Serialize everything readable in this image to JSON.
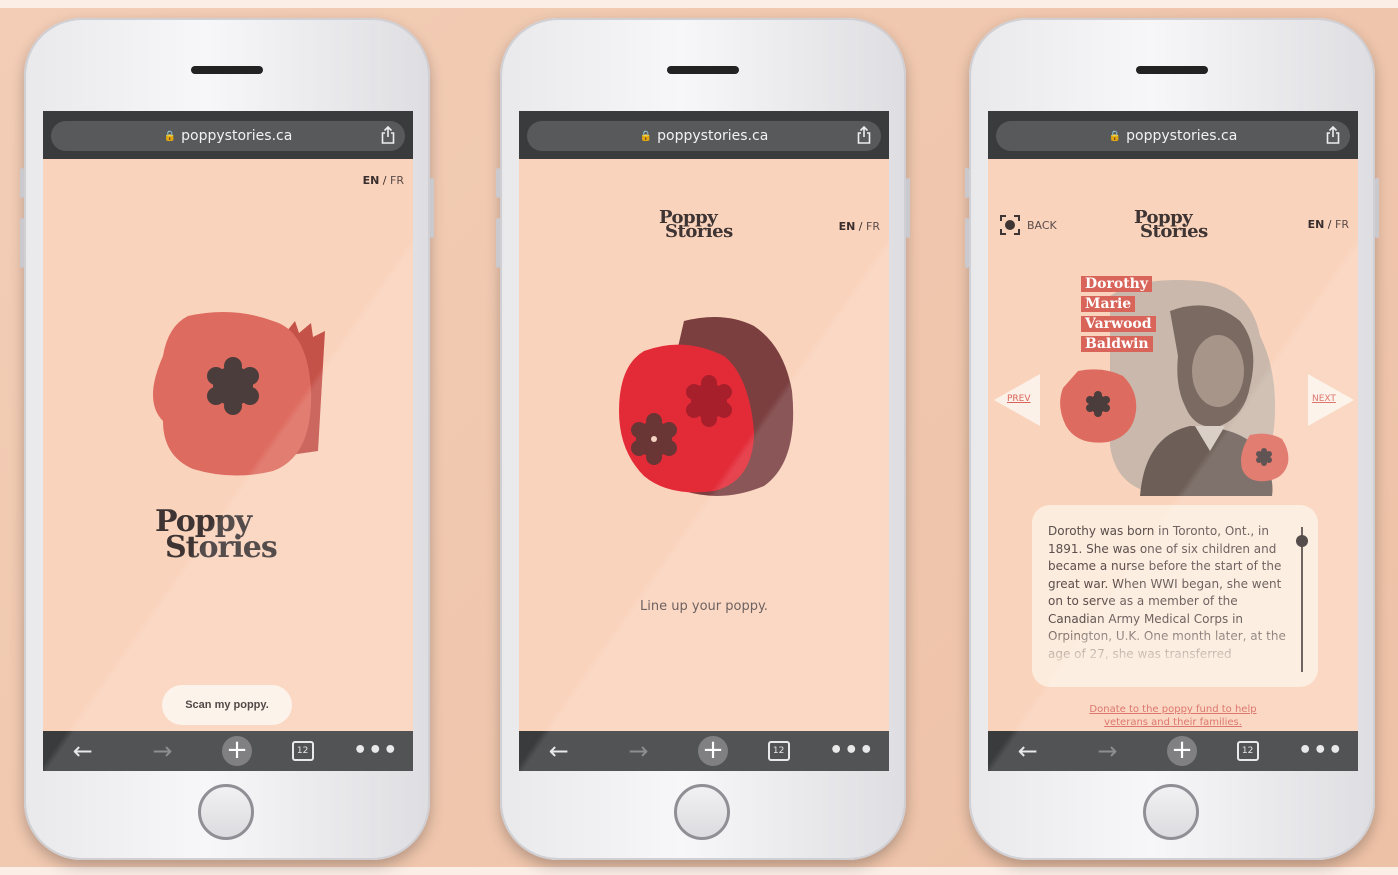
{
  "browser": {
    "url": "poppystories.ca",
    "tab_count": "12"
  },
  "language": {
    "en": "EN",
    "sep": "/",
    "fr": "FR"
  },
  "logo": {
    "line1": "Poppy",
    "line2": "Stories"
  },
  "screen1": {
    "scan_button": "Scan my poppy."
  },
  "screen2": {
    "instruction": "Line up your poppy."
  },
  "screen3": {
    "back_label": "BACK",
    "name_lines": [
      "Dorothy",
      "Marie",
      "Varwood",
      "Baldwin"
    ],
    "prev_label": "PREV",
    "next_label": "NEXT",
    "bio": "Dorothy was born in Toronto, Ont., in 1891. She was one of six children and became a nurse before the start of the great war. When WWI began, she went on to serve as a member of the Canadian Army Medical Corps in Orpington, U.K. One month later, at the age of 27, she was transferred",
    "donate_line1": "Donate to the poppy fund to help",
    "donate_line2": "veterans and their families."
  },
  "colors": {
    "screen_bg": "#fad3bc",
    "poppy_red": "#d8645a",
    "bright_red": "#e32b38",
    "dark_brown": "#3d3433",
    "browser_chrome": "#3a3b3d"
  }
}
